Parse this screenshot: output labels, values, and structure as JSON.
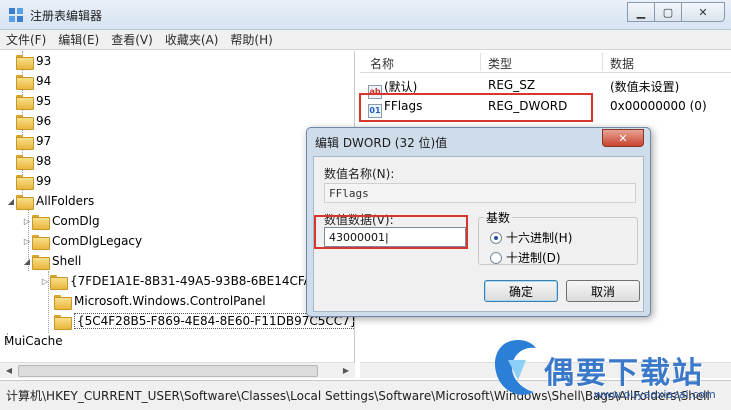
{
  "window": {
    "title": "注册表编辑器",
    "buttons": [
      "minimize",
      "maximize",
      "close"
    ]
  },
  "menu": [
    "文件(F)",
    "编辑(E)",
    "查看(V)",
    "收藏夹(A)",
    "帮助(H)"
  ],
  "tree": {
    "items": [
      {
        "label": "93"
      },
      {
        "label": "94"
      },
      {
        "label": "95"
      },
      {
        "label": "96"
      },
      {
        "label": "97"
      },
      {
        "label": "98"
      },
      {
        "label": "99"
      },
      {
        "label": "AllFolders"
      },
      {
        "label": "ComDlg"
      },
      {
        "label": "ComDlgLegacy"
      },
      {
        "label": "Shell"
      },
      {
        "label": "{7FDE1A1E-8B31-49A5-93B8-6BE14CFA4"
      },
      {
        "label": "Microsoft.Windows.ControlPanel"
      },
      {
        "label": "{5C4F28B5-F869-4E84-8E60-F11DB97C5CC7}"
      },
      {
        "label": "MuiCache"
      }
    ]
  },
  "list": {
    "columns": [
      "名称",
      "类型",
      "数据"
    ],
    "rows": [
      {
        "name": "(默认)",
        "type": "REG_SZ",
        "data": "(数值未设置)",
        "icon": "ab"
      },
      {
        "name": "FFlags",
        "type": "REG_DWORD",
        "data": "0x00000000 (0)",
        "icon": "binary"
      }
    ]
  },
  "dialog": {
    "title": "编辑 DWORD (32 位)值",
    "name_label": "数值名称(N):",
    "name_value": "FFlags",
    "data_label": "数值数据(V):",
    "data_value": "43000001",
    "base_label": "基数",
    "hex_label": "十六进制(H)",
    "dec_label": "十进制(D)",
    "ok_label": "确定",
    "cancel_label": "取消",
    "base_selected": "hex"
  },
  "status": {
    "path": "计算机\\HKEY_CURRENT_USER\\Software\\Classes\\Local Settings\\Software\\Microsoft\\Windows\\Shell\\Bags\\AllFolders\\Shell"
  },
  "watermark": {
    "text": "偶要下载站",
    "url": "www.ouyaoxiazai.com"
  },
  "colors": {
    "highlight": "#d9352f",
    "dialog_frame": "#cfdcea"
  }
}
